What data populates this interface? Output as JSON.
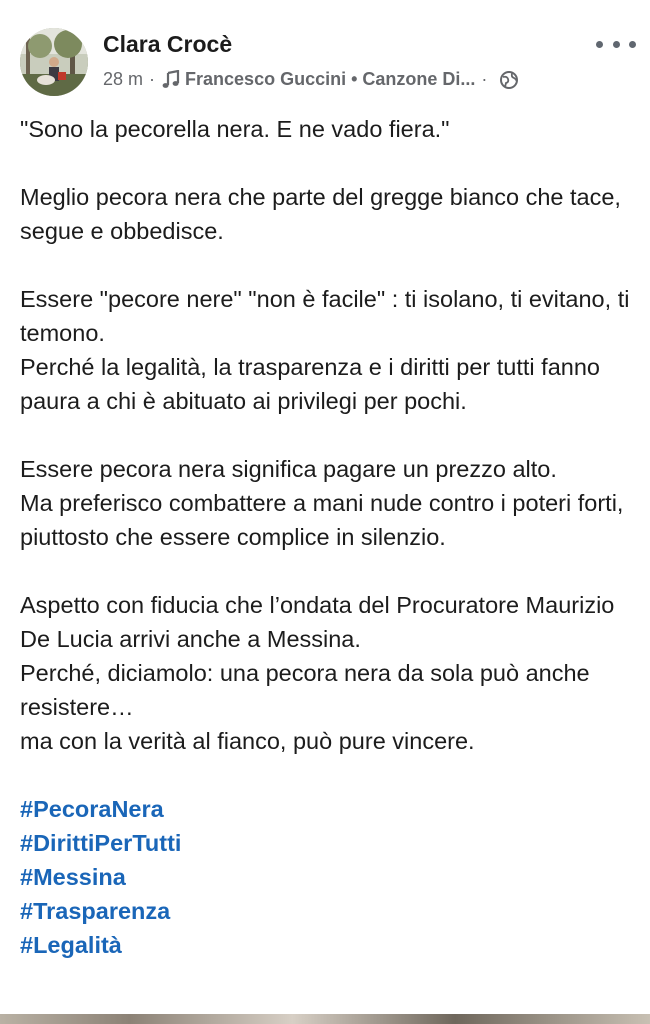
{
  "header": {
    "author": "Clara Crocè",
    "time": "28 m",
    "separator": "·",
    "song": "Francesco Guccini • Canzone Di...",
    "icons": {
      "music": "music-note-icon",
      "globe": "globe-icon",
      "more": "more-options-icon"
    }
  },
  "post": {
    "paragraphs": [
      "\"Sono la pecorella nera. E ne vado fiera.\"",
      "Meglio pecora nera che parte del gregge bianco che tace, segue e obbedisce.",
      "Essere \"pecore nere\" \"non è facile\" : ti isolano, ti evitano, ti temono.",
      "Perché la legalità, la trasparenza e i diritti per tutti fanno paura a chi è abituato ai privilegi per pochi.",
      "Essere pecora nera significa pagare un prezzo alto.",
      "Ma preferisco combattere a mani nude contro i poteri forti,",
      "piuttosto che essere complice in silenzio.",
      "Aspetto con fiducia che l’ondata del Procuratore Maurizio De Lucia arrivi anche a Messina.",
      "Perché, diciamolo: una pecora nera da sola può anche resistere…",
      "ma con la verità al fianco, può pure vincere."
    ],
    "hashtags": [
      "#PecoraNera",
      "#DirittiPerTutti",
      "#Messina",
      "#Trasparenza",
      "#Legalità"
    ]
  },
  "colors": {
    "hashtag": "#1a66b8",
    "meta": "#65676b",
    "text": "#1c1c1c"
  }
}
